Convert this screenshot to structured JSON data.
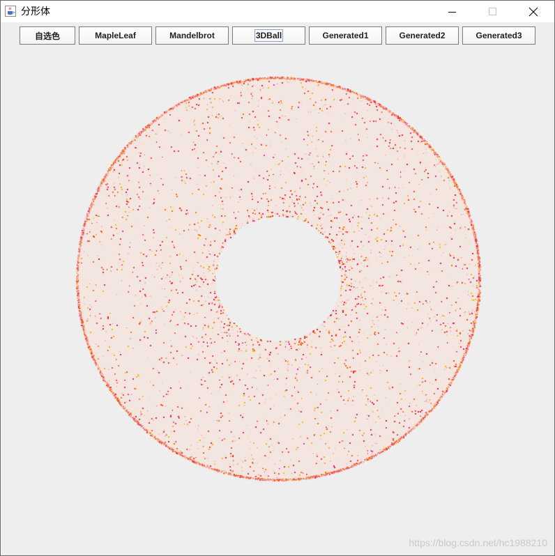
{
  "window": {
    "title": "分形体",
    "icon": "java-cup-icon"
  },
  "toolbar": {
    "buttons": [
      {
        "label": "自选色"
      },
      {
        "label": "MapleLeaf"
      },
      {
        "label": "Mandelbrot"
      },
      {
        "label": "3DBall"
      },
      {
        "label": "Generated1"
      },
      {
        "label": "Generated2"
      },
      {
        "label": "Generated3"
      }
    ]
  },
  "fractal": {
    "shape": "torus",
    "background_color": "#eeeeee",
    "ring_fill_color": "#f3e6e1",
    "point_colors": [
      "#ff3c1e",
      "#e0196e",
      "#ffb400",
      "#ff6a00",
      "#d81c3c"
    ]
  },
  "watermark": "https://blog.csdn.net/hc1988210"
}
